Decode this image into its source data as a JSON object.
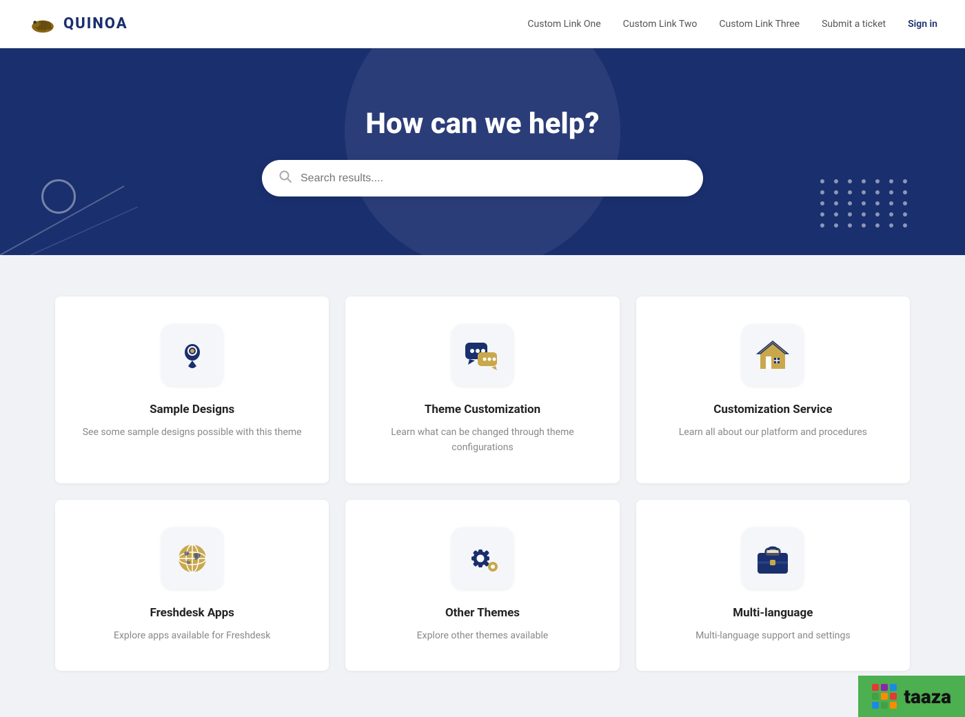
{
  "header": {
    "logo_text": "QUINOA",
    "nav_items": [
      {
        "label": "Custom Link One",
        "id": "nav-link-one"
      },
      {
        "label": "Custom Link Two",
        "id": "nav-link-two"
      },
      {
        "label": "Custom Link Three",
        "id": "nav-link-three"
      },
      {
        "label": "Submit a ticket",
        "id": "nav-submit"
      },
      {
        "label": "Sign in",
        "id": "nav-signin"
      }
    ]
  },
  "hero": {
    "title": "How can we help?",
    "search_placeholder": "Search results...."
  },
  "cards": [
    {
      "id": "sample-designs",
      "title": "Sample Designs",
      "desc": "See some sample designs possible with this theme",
      "icon": "pin"
    },
    {
      "id": "theme-customization",
      "title": "Theme Customization",
      "desc": "Learn what can be changed through theme configurations",
      "icon": "chat"
    },
    {
      "id": "customization-service",
      "title": "Customization Service",
      "desc": "Learn all about our platform and procedures",
      "icon": "home"
    },
    {
      "id": "freshdesk-apps",
      "title": "Freshdesk Apps",
      "desc": "Explore apps available for Freshdesk",
      "icon": "globe"
    },
    {
      "id": "other-themes",
      "title": "Other Themes",
      "desc": "Explore other themes available",
      "icon": "gear"
    },
    {
      "id": "multi-language",
      "title": "Multi-language",
      "desc": "Multi-language support and settings",
      "icon": "briefcase"
    }
  ],
  "colors": {
    "brand_dark": "#1a2f6e",
    "brand_gold": "#c9a84c",
    "text_muted": "#888888"
  }
}
